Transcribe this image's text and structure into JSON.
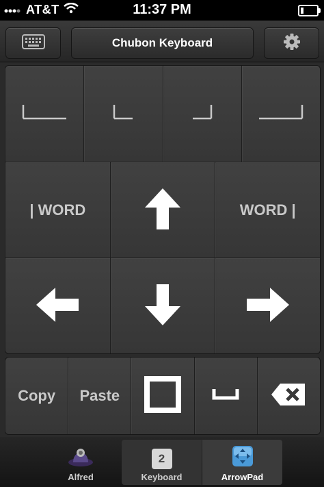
{
  "status_bar": {
    "carrier": "AT&T",
    "time": "11:37 PM",
    "icons": [
      "signal-bars-icon",
      "wifi-icon",
      "battery-icon"
    ]
  },
  "nav_bar": {
    "title": "Chubon Keyboard",
    "left_icon": "keyboard-icon",
    "right_icon": "gear-icon"
  },
  "cursor_row": {
    "icons": [
      "line-start-icon",
      "word-start-icon",
      "word-end-icon",
      "line-end-icon"
    ]
  },
  "arrow_keys": {
    "word_left_label": "| WORD",
    "word_right_label": "WORD |",
    "icons": [
      "arrow-up-icon",
      "arrow-left-icon",
      "arrow-down-icon",
      "arrow-right-icon"
    ]
  },
  "edit_row": {
    "copy_label": "Copy",
    "paste_label": "Paste",
    "icons": [
      "select-square-icon",
      "space-icon",
      "backspace-icon"
    ]
  },
  "tab_bar": {
    "tabs": [
      {
        "label": "Alfred",
        "icon": "alfred-hat-icon",
        "selected": false
      },
      {
        "label": "Keyboard",
        "icon": "keyboard-number-icon",
        "badge": "2",
        "selected": false
      },
      {
        "label": "ArrowPad",
        "icon": "arrowpad-icon",
        "selected": true
      }
    ]
  },
  "colors": {
    "background": "#2a2a2a",
    "key_face": "#3c3c3c",
    "key_text": "#c9c9c9",
    "status_bar": "#000000"
  }
}
